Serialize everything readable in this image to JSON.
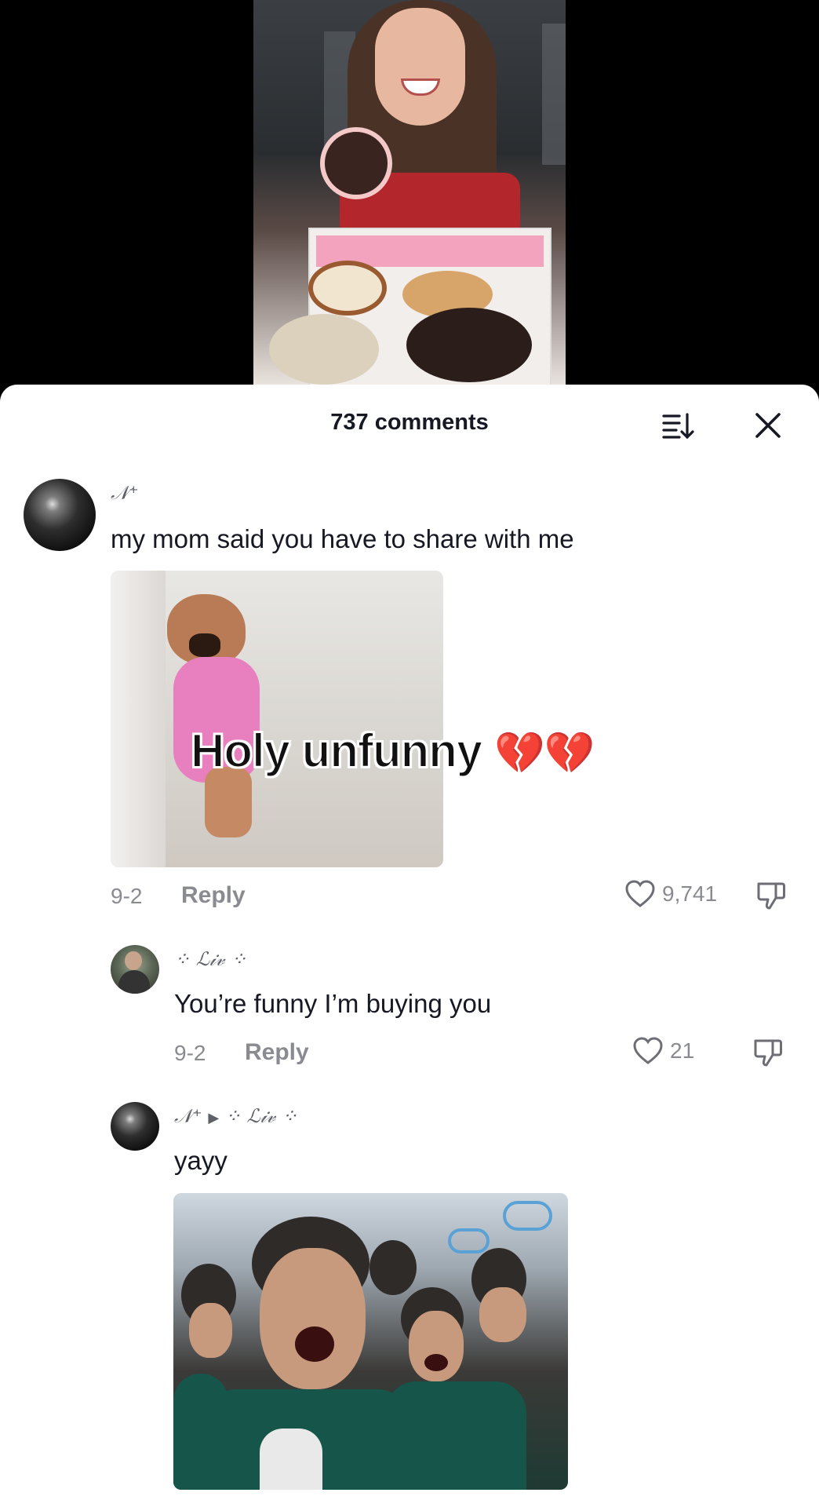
{
  "header": {
    "comment_count_label": "737 comments"
  },
  "comments": [
    {
      "username": "𝒩⁺",
      "text": "my mom said you have to share with me",
      "gif_caption": "Holy unfunny",
      "gif_caption_emoji": "💔💔",
      "date": "9-2",
      "reply_label": "Reply",
      "likes": "9,741"
    },
    {
      "username": "⁘ ℒ𝒾𝓋 ⁘",
      "text": "You’re funny I’m buying you",
      "date": "9-2",
      "reply_label": "Reply",
      "likes": "21"
    },
    {
      "username": "𝒩⁺",
      "reply_to_arrow": "▶",
      "reply_to": "⁘ ℒ𝒾𝓋 ⁘",
      "text": "yayy"
    }
  ],
  "colors": {
    "sheet_bg": "#ffffff",
    "text_primary": "#161823",
    "text_secondary": "#8a8b91",
    "heart_emoji": "#d3172f"
  },
  "icons": [
    "sort-icon",
    "close-icon",
    "heart-outline-icon",
    "dislike-icon"
  ]
}
